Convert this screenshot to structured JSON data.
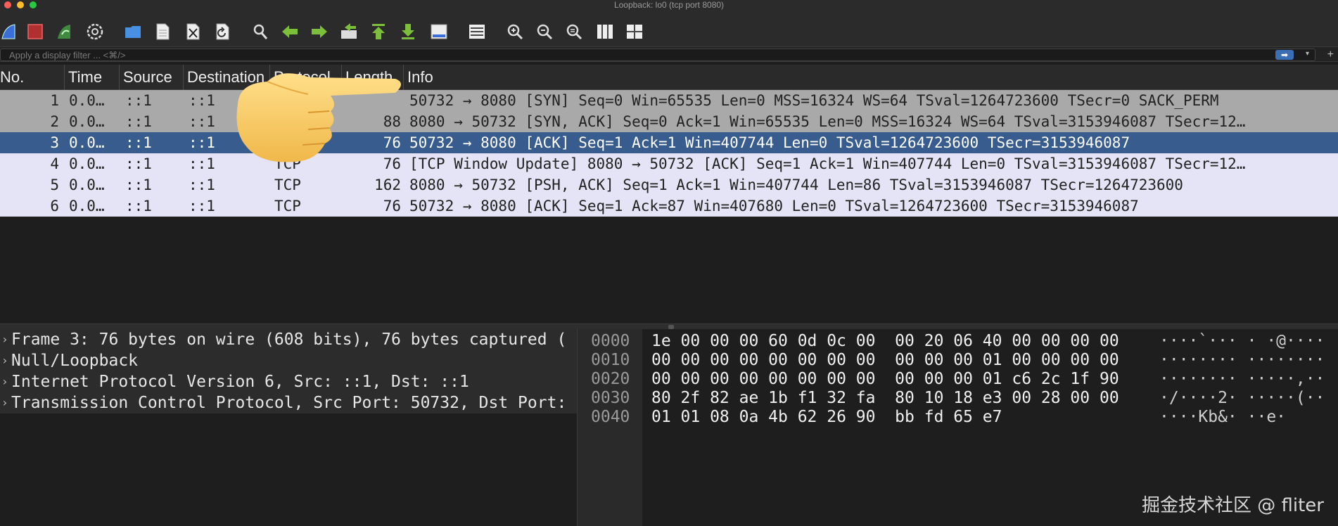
{
  "window": {
    "title": "Loopback: lo0 (tcp port 8080)"
  },
  "toolbar": {
    "buttons": [
      {
        "name": "start-capture-fin-icon",
        "color": "#3a6fd8"
      },
      {
        "name": "stop-capture-icon",
        "color": "#c0392b"
      },
      {
        "name": "restart-capture-fin-icon",
        "color": "#3f8a3f"
      },
      {
        "name": "capture-options-gear-icon",
        "color": "#dddddd"
      },
      {
        "name": "open-file-folder-icon",
        "color": "#4a90e2"
      },
      {
        "name": "save-file-icon",
        "color": "#dddddd"
      },
      {
        "name": "close-file-icon",
        "color": "#dddddd"
      },
      {
        "name": "reload-file-icon",
        "color": "#dddddd"
      },
      {
        "name": "find-packet-icon",
        "color": "#dddddd"
      },
      {
        "name": "go-back-arrow-icon",
        "color": "#7bbf3a"
      },
      {
        "name": "go-forward-arrow-icon",
        "color": "#7bbf3a"
      },
      {
        "name": "go-to-packet-icon",
        "color": "#7bbf3a"
      },
      {
        "name": "go-first-packet-icon",
        "color": "#7bbf3a"
      },
      {
        "name": "go-last-packet-icon",
        "color": "#7bbf3a"
      },
      {
        "name": "auto-scroll-icon",
        "color": "#dddddd"
      },
      {
        "name": "colorize-icon",
        "color": "#dddddd"
      },
      {
        "name": "zoom-in-icon",
        "color": "#dddddd"
      },
      {
        "name": "zoom-out-icon",
        "color": "#dddddd"
      },
      {
        "name": "zoom-normal-icon",
        "color": "#dddddd"
      },
      {
        "name": "resize-columns-icon",
        "color": "#dddddd"
      },
      {
        "name": "expand-subtrees-icon",
        "color": "#dddddd"
      }
    ]
  },
  "filter": {
    "placeholder": "Apply a display filter ... <⌘/>",
    "apply_label": "➡",
    "dropdown": "▾",
    "add": "+"
  },
  "packet_list": {
    "columns": [
      "No.",
      "Time",
      "Source",
      "Destination",
      "Protocol",
      "Length",
      "Info"
    ],
    "rows": [
      {
        "no": "1",
        "time": "0.0…",
        "src": "::1",
        "dst": "::1",
        "proto": "",
        "len": "",
        "info": "50732 → 8080 [SYN] Seq=0 Win=65535 Len=0 MSS=16324 WS=64 TSval=1264723600 TSecr=0 SACK_PERM",
        "bg": "#a9a9a9"
      },
      {
        "no": "2",
        "time": "0.0…",
        "src": "::1",
        "dst": "::1",
        "proto": "",
        "len": "88",
        "info": "8080 → 50732 [SYN, ACK] Seq=0 Ack=1 Win=65535 Len=0 MSS=16324 WS=64 TSval=3153946087 TSecr=12…",
        "bg": "#a9a9a9"
      },
      {
        "no": "3",
        "time": "0.0…",
        "src": "::1",
        "dst": "::1",
        "proto": "",
        "len": "76",
        "info": "50732 → 8080 [ACK] Seq=1 Ack=1 Win=407744 Len=0 TSval=1264723600 TSecr=3153946087",
        "bg": "#385c8e"
      },
      {
        "no": "4",
        "time": "0.0…",
        "src": "::1",
        "dst": "::1",
        "proto": "TCP",
        "len": "76",
        "info": "[TCP Window Update] 8080 → 50732 [ACK] Seq=1 Ack=1 Win=407744 Len=0 TSval=3153946087 TSecr=12…",
        "bg": "#e4e4f6"
      },
      {
        "no": "5",
        "time": "0.0…",
        "src": "::1",
        "dst": "::1",
        "proto": "TCP",
        "len": "162",
        "info": "8080 → 50732 [PSH, ACK] Seq=1 Ack=1 Win=407744 Len=86 TSval=3153946087 TSecr=1264723600",
        "bg": "#e4e4f6"
      },
      {
        "no": "6",
        "time": "0.0…",
        "src": "::1",
        "dst": "::1",
        "proto": "TCP",
        "len": "76",
        "info": "50732 → 8080 [ACK] Seq=1 Ack=87 Win=407680 Len=0 TSval=1264723600 TSecr=3153946087",
        "bg": "#e4e4f6"
      }
    ]
  },
  "details": {
    "rows": [
      "Frame 3: 76 bytes on wire (608 bits), 76 bytes captured (",
      "Null/Loopback",
      "Internet Protocol Version 6, Src: ::1, Dst: ::1",
      "Transmission Control Protocol, Src Port: 50732, Dst Port:"
    ],
    "expander": "›"
  },
  "bytes": {
    "rows": [
      {
        "off": "0000",
        "hex": "1e 00 00 00 60 0d 0c 00  00 20 06 40 00 00 00 00",
        "asc": "····`··· · ·@····"
      },
      {
        "off": "0010",
        "hex": "00 00 00 00 00 00 00 00  00 00 00 01 00 00 00 00",
        "asc": "········ ········"
      },
      {
        "off": "0020",
        "hex": "00 00 00 00 00 00 00 00  00 00 00 01 c6 2c 1f 90",
        "asc": "········ ·····,··"
      },
      {
        "off": "0030",
        "hex": "80 2f 82 ae 1b f1 32 fa  80 10 18 e3 00 28 00 00",
        "asc": "·/····2· ·····(··"
      },
      {
        "off": "0040",
        "hex": "01 01 08 0a 4b 62 26 90  bb fd 65 e7",
        "asc": "····Kb&· ··e·"
      }
    ]
  },
  "watermark": "掘金技术社区 @ fliter"
}
